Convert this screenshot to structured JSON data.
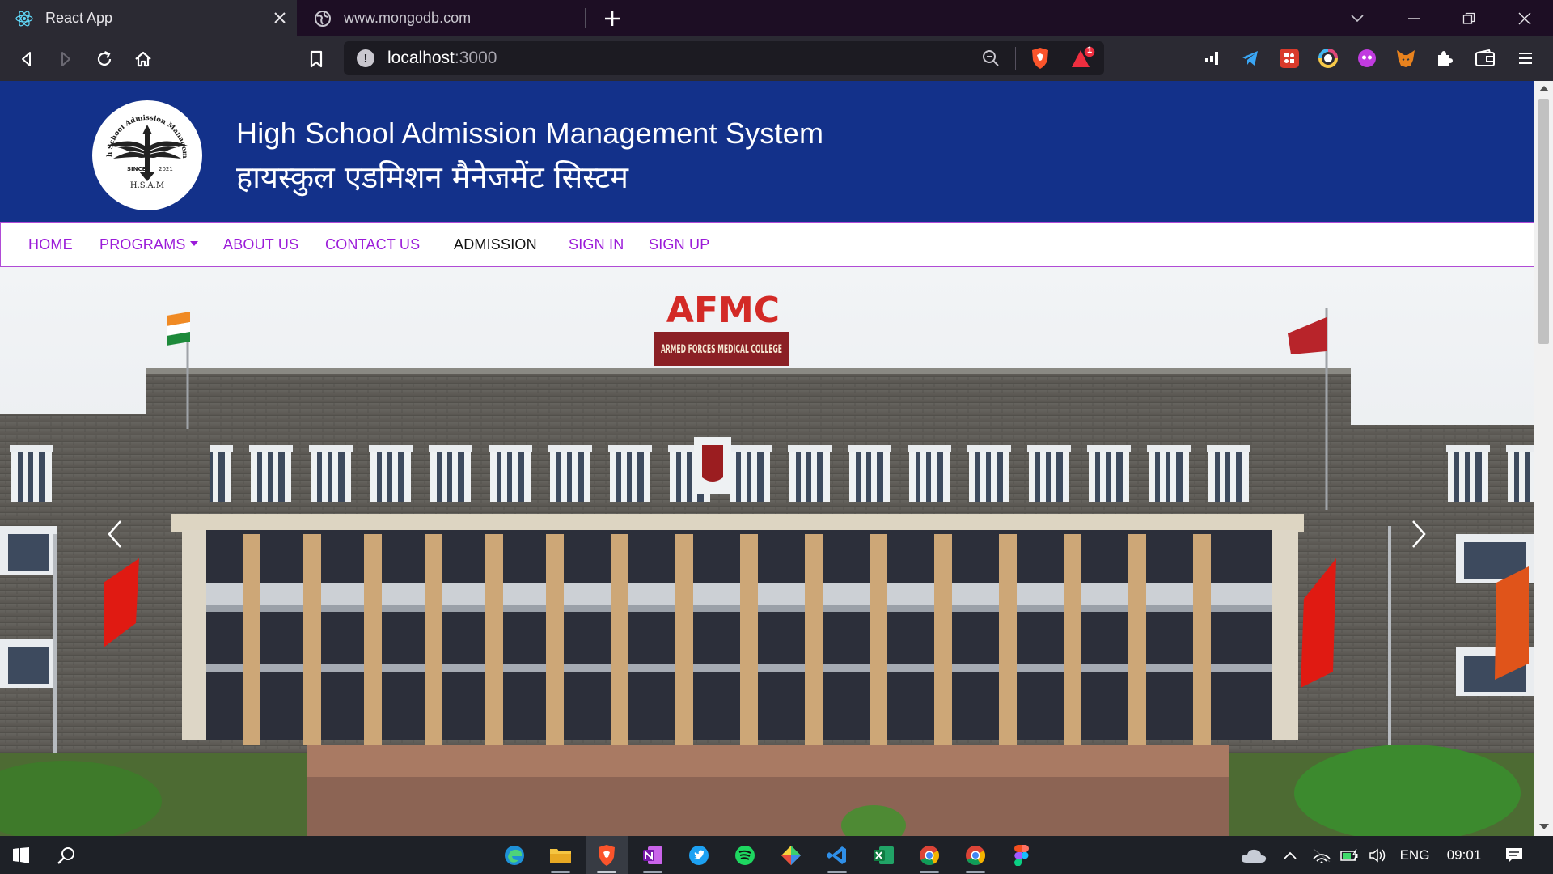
{
  "browser": {
    "tabs": [
      {
        "title": "React App",
        "active": true
      },
      {
        "title": "www.mongodb.com",
        "active": false
      }
    ],
    "url": {
      "host": "localhost",
      "port": ":3000"
    },
    "shields_badge": "1"
  },
  "site": {
    "logo": {
      "ring_text": "High School Admission Management",
      "since": "SINCE",
      "year": "2021",
      "abbr": "H.S.A.M"
    },
    "title_en": "High School Admission Management System",
    "title_hi": "हायस्कुल एडमिशन मैनेजमेंट सिस्टम",
    "nav": [
      {
        "label": "HOME",
        "active": false
      },
      {
        "label": "PROGRAMS",
        "active": false,
        "dropdown": true
      },
      {
        "label": "ABOUT US",
        "active": false
      },
      {
        "label": "CONTACT US",
        "active": false
      },
      {
        "label": "ADMISSION",
        "active": true
      },
      {
        "label": "SIGN IN",
        "active": false
      },
      {
        "label": "SIGN UP",
        "active": false
      }
    ],
    "hero": {
      "building_sign": "AFMC",
      "sub_sign": "ARMED FORCES MEDICAL COLLEGE"
    }
  },
  "taskbar": {
    "lang": "ENG",
    "time": "09:01"
  },
  "colors": {
    "header": "#13318a",
    "nav_link": "#9b1bd9",
    "nav_border": "#b04bd6"
  }
}
